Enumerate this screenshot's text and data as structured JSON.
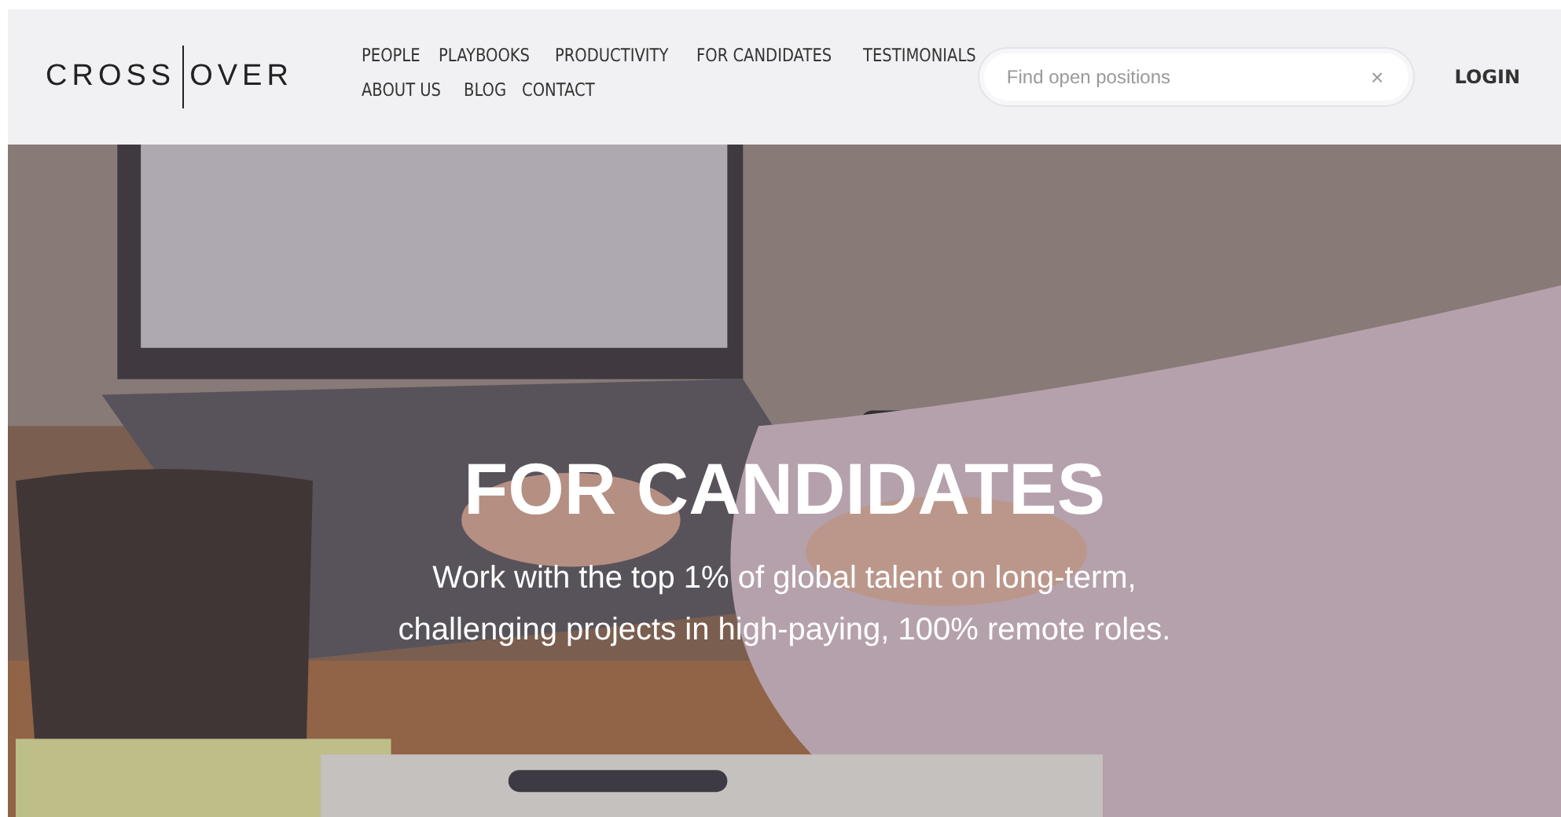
{
  "logo": {
    "left": "CROSS",
    "right": "OVER"
  },
  "nav": {
    "rows": [
      [
        "PEOPLE",
        "PLAYBOOKS",
        "PRODUCTIVITY",
        "FOR CANDIDATES",
        "TESTIMONIALS"
      ],
      [
        "ABOUT US",
        "BLOG",
        "CONTACT"
      ]
    ]
  },
  "search": {
    "placeholder": "Find open positions",
    "clear": "×"
  },
  "login": "LOGIN",
  "hero": {
    "kind": "picture",
    "title": "FOR CANDIDATES",
    "subtitle_lines": [
      "Work with the top 1% of global talent on long-term,",
      "challenging projects in high-paying, 100% remote roles."
    ]
  }
}
